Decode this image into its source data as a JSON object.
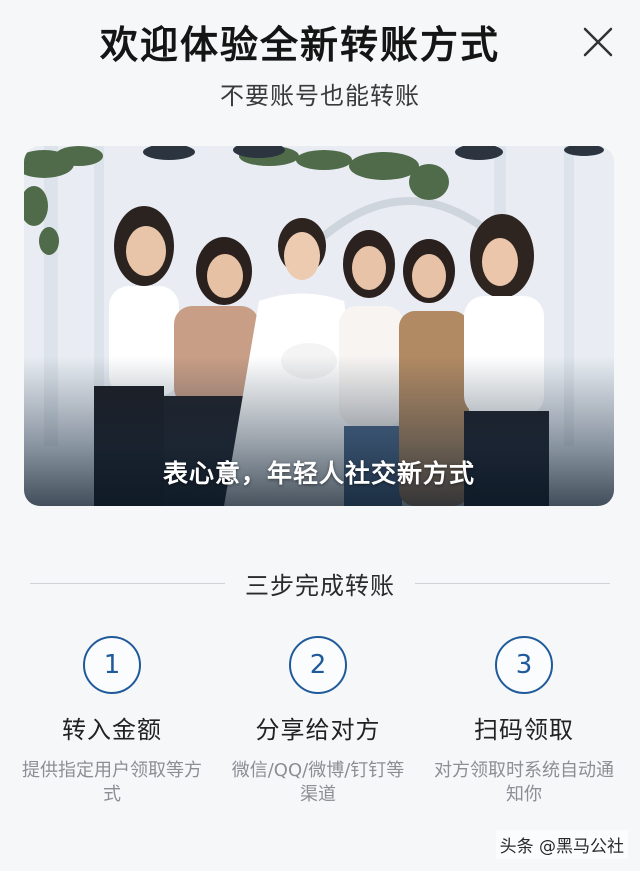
{
  "header": {
    "title": "欢迎体验全新转账方式",
    "subtitle": "不要账号也能转账",
    "close_icon": "close-icon"
  },
  "banner": {
    "caption": "表心意，年轻人社交新方式"
  },
  "section": {
    "heading": "三步完成转账"
  },
  "steps": [
    {
      "number": "1",
      "title": "转入金额",
      "description": "提供指定用户领取等方式"
    },
    {
      "number": "2",
      "title": "分享给对方",
      "description": "微信/QQ/微博/钉钉等渠道"
    },
    {
      "number": "3",
      "title": "扫码领取",
      "description": "对方领取时系统自动通知你"
    }
  ],
  "watermark": "头条 @黑马公社",
  "colors": {
    "accent": "#1f5a9a",
    "background": "#f6f7f9"
  }
}
